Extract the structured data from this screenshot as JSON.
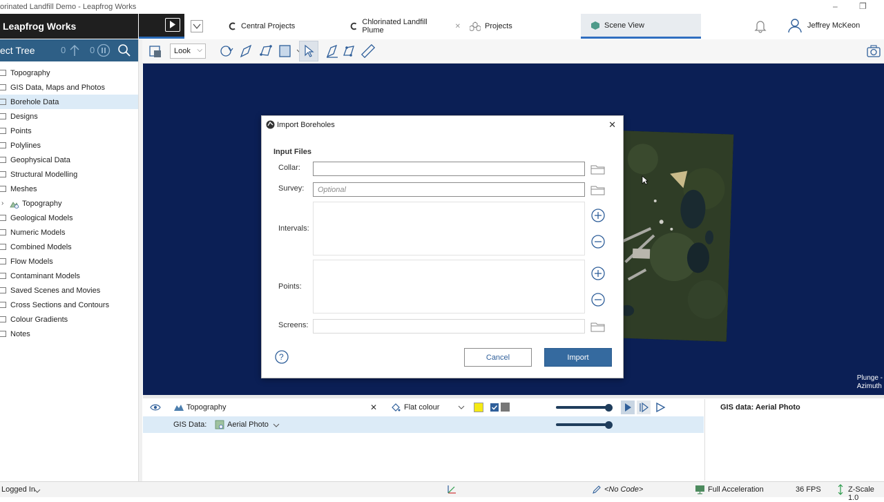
{
  "window": {
    "title": "orinated Landfill Demo - Leapfrog Works",
    "min_glyph": "–",
    "restore_glyph": "❐"
  },
  "header": {
    "app_name": "Leapfrog Works",
    "tabs": [
      {
        "label": "Central Projects",
        "icon": "central-icon"
      },
      {
        "label": "Chlorinated Landfill Plume",
        "icon": "central-icon",
        "close": "✕"
      },
      {
        "label": "Projects",
        "icon": "projects-icon"
      },
      {
        "label": "Scene View",
        "icon": "scene-icon",
        "active": true
      }
    ],
    "user_name": "Jeffrey McKeon"
  },
  "tree": {
    "title": "ect Tree",
    "count_a": "0",
    "count_b": "0",
    "items": [
      {
        "label": "Topography"
      },
      {
        "label": "GIS Data, Maps and Photos"
      },
      {
        "label": "Borehole Data",
        "selected": true
      },
      {
        "label": "Designs"
      },
      {
        "label": "Points"
      },
      {
        "label": "Polylines"
      },
      {
        "label": "Geophysical Data"
      },
      {
        "label": "Structural Modelling"
      },
      {
        "label": "Meshes"
      },
      {
        "label": "Topography",
        "expandable": true,
        "special": true
      },
      {
        "label": "Geological Models"
      },
      {
        "label": "Numeric Models"
      },
      {
        "label": "Combined Models"
      },
      {
        "label": "Flow Models"
      },
      {
        "label": "Contaminant Models"
      },
      {
        "label": "Saved Scenes and Movies"
      },
      {
        "label": "Cross Sections and Contours"
      },
      {
        "label": "Colour Gradients"
      },
      {
        "label": "Notes"
      }
    ]
  },
  "toolbar": {
    "look_label": "Look",
    "look_arrow": "⌵"
  },
  "scene": {
    "plunge_label": "Plunge -",
    "azimuth_label": "Azimuth"
  },
  "dialog": {
    "title": "Import Boreholes",
    "close_glyph": "✕",
    "section": "Input Files",
    "collar_label": "Collar:",
    "collar_value": "",
    "survey_label": "Survey:",
    "survey_placeholder": "Optional",
    "intervals_label": "Intervals:",
    "points_label": "Points:",
    "screens_label": "Screens:",
    "screens_value": "",
    "cancel_label": "Cancel",
    "import_label": "Import",
    "help_glyph": "?"
  },
  "shape_list": {
    "row1_name": "Topography",
    "remove_glyph": "✕",
    "colour_mode": "Flat colour",
    "row2_label": "GIS Data:",
    "row2_value": "Aerial Photo",
    "dropdown_glyph": "⌵",
    "swatch_color": "#f5ea14",
    "opacity_row1": 0.93,
    "opacity_row2": 0.93
  },
  "properties": {
    "heading": "GIS data: Aerial Photo"
  },
  "statusbar": {
    "logged_in": "Logged In",
    "code": "<No Code>",
    "acceleration": "Full Acceleration",
    "fps": "36 FPS",
    "zscale": "Z-Scale 1.0"
  },
  "colors": {
    "brand_dark": "#1f1f1f",
    "tree_header": "#2e5f86",
    "scene_bg": "#0b1f55",
    "accent": "#356a9f",
    "selection": "#dcebf7"
  }
}
